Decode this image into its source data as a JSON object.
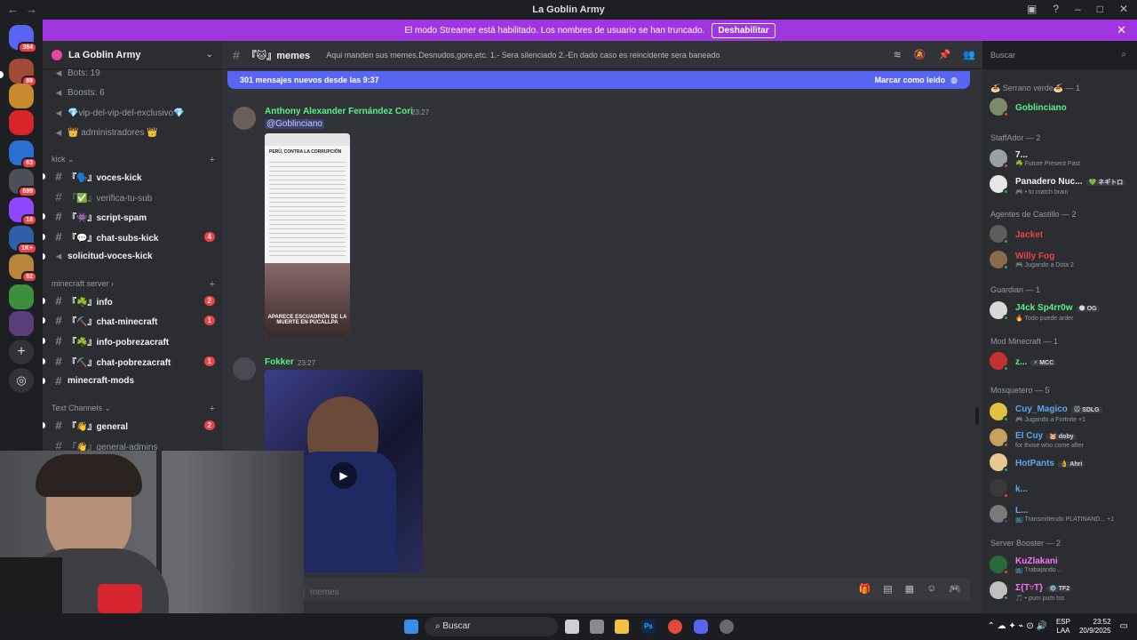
{
  "window": {
    "title": "La Goblin Army",
    "nav_back": "←",
    "nav_forward": "→"
  },
  "banner": {
    "message": "El modo Streamer está habilitado. Los nombres de usuario se han truncado.",
    "button": "Deshabilitar"
  },
  "rail": {
    "badges": [
      "384",
      "89",
      "699",
      "18",
      "1K+",
      "92",
      "63"
    ]
  },
  "sidebar": {
    "guild_name": "La Goblin Army",
    "top_items": [
      {
        "label": "Bots: 19"
      },
      {
        "label": "Boosts: 6"
      },
      {
        "label": "💎vip-del-vip-del-exclusivo💎"
      },
      {
        "label": "👑 administradores 👑"
      }
    ],
    "categories": [
      {
        "name": "kick",
        "channels": [
          {
            "label": "『🗣️』voces-kick",
            "unread": true,
            "mentions": ""
          },
          {
            "label": "『✅』verifica-tu-sub",
            "unread": false,
            "mentions": ""
          },
          {
            "label": "『👾』script-spam",
            "unread": true,
            "mentions": ""
          },
          {
            "label": "『💬』chat-subs-kick",
            "unread": true,
            "mentions": "4"
          },
          {
            "label": "solicitud-voces-kick",
            "unread": true,
            "mentions": ""
          }
        ]
      },
      {
        "name": "minecraft server",
        "channels": [
          {
            "label": "『☘️』info",
            "unread": true,
            "mentions": "2"
          },
          {
            "label": "『⛏️』chat-minecraft",
            "unread": true,
            "mentions": "1"
          },
          {
            "label": "『☘️』info-pobrezacraft",
            "unread": true,
            "mentions": ""
          },
          {
            "label": "『⛏️』chat-pobrezacraft",
            "unread": true,
            "mentions": "1"
          },
          {
            "label": "minecraft-mods",
            "unread": true,
            "mentions": ""
          }
        ]
      },
      {
        "name": "Text Channels",
        "channels": [
          {
            "label": "『👋』general",
            "unread": true,
            "mentions": "2"
          },
          {
            "label": "『👋』general-admins",
            "unread": false,
            "mentions": ""
          }
        ]
      }
    ]
  },
  "channel": {
    "name": "『🐱』memes",
    "topic": "Aqui manden sus memes.Desnudos,gore,etc. 1.- Sera silenciado 2.-En dado caso es reincidente sera baneado",
    "search_placeholder": "Buscar"
  },
  "new_messages": {
    "text": "301 mensajes nuevos desde las 9:37",
    "action": "Marcar como leído"
  },
  "messages": [
    {
      "author": "Anthony Alexander Fernández Cori",
      "time": "23:27",
      "mention": "@Goblinciano",
      "image_caption": "APARECE ESCUADRÓN DE LA MUERTE EN PUCALLPA",
      "image_header": "PERÚ, CONTRA LA CORRUPCIÓN"
    },
    {
      "author": "Fokker",
      "time": "23:27"
    }
  ],
  "composer": {
    "placeholder": "nsaje a #『🐱』memes"
  },
  "members": {
    "groups": [
      {
        "title": "🍝 Serrano verde🍝 — 1",
        "members": [
          {
            "name": "Goblinciano",
            "color": "#57f287",
            "status": "",
            "tag": ""
          }
        ]
      },
      {
        "title": "StaffAdor — 2",
        "members": [
          {
            "name": "7...",
            "color": "#f2f3f5",
            "status": "☘️ Future Present Past",
            "tag": ""
          },
          {
            "name": "Panadero Nuc...",
            "color": "#f2f3f5",
            "status": "🎮 • to match brain",
            "tag": "💚 ネギトロ"
          }
        ]
      },
      {
        "title": "Agentes de Castillo — 2",
        "members": [
          {
            "name": "Jacket",
            "color": "#ed4245",
            "status": "",
            "tag": ""
          },
          {
            "name": "Willy Fog",
            "color": "#ed4245",
            "status": "🎮 Jugando a Dota 2",
            "tag": ""
          }
        ]
      },
      {
        "title": "Guardian — 1",
        "members": [
          {
            "name": "J4ck Sp4rr0w",
            "color": "#57f287",
            "status": "🔥 Todo puede arder",
            "tag": "🌑 OG"
          }
        ]
      },
      {
        "title": "Mod Minecraft — 1",
        "members": [
          {
            "name": "z...",
            "color": "#57f287",
            "status": "",
            "tag": "⚡ MCC"
          }
        ]
      },
      {
        "title": "Mosquetero — 5",
        "members": [
          {
            "name": "Cuy_Magico",
            "color": "#5ca8f0",
            "status": "🎮 Jugando a Fortnite +1",
            "tag": "🐭 SDLG"
          },
          {
            "name": "El Cuy",
            "color": "#5ca8f0",
            "status": "for those who come after",
            "tag": "🐹 doby"
          },
          {
            "name": "HotPants",
            "color": "#5ca8f0",
            "status": "",
            "tag": "👌 Ahri"
          },
          {
            "name": "k...",
            "color": "#5ca8f0",
            "status": "",
            "tag": ""
          },
          {
            "name": "L...",
            "color": "#5ca8f0",
            "status": "📺 Transmitiendo PLATINAND... +1",
            "tag": ""
          }
        ]
      },
      {
        "title": "Server Booster — 2",
        "members": [
          {
            "name": "KuZlakani",
            "color": "#ff73fa",
            "status": "📺 Trabajando ...",
            "tag": ""
          },
          {
            "name": "Σ{T▿T}",
            "color": "#ff73fa",
            "status": "🎵 • pum pum tss",
            "tag": "⚙️ TF2"
          }
        ]
      }
    ]
  },
  "taskbar": {
    "search": "Buscar",
    "lang_top": "ESP",
    "lang_bottom": "LAA",
    "time": "23:52",
    "date": "20/9/2025"
  },
  "colors": {
    "banner": "#a136e0",
    "accent": "#5865f2",
    "mention_badge": "#f23f43",
    "author_green": "#57f287"
  }
}
